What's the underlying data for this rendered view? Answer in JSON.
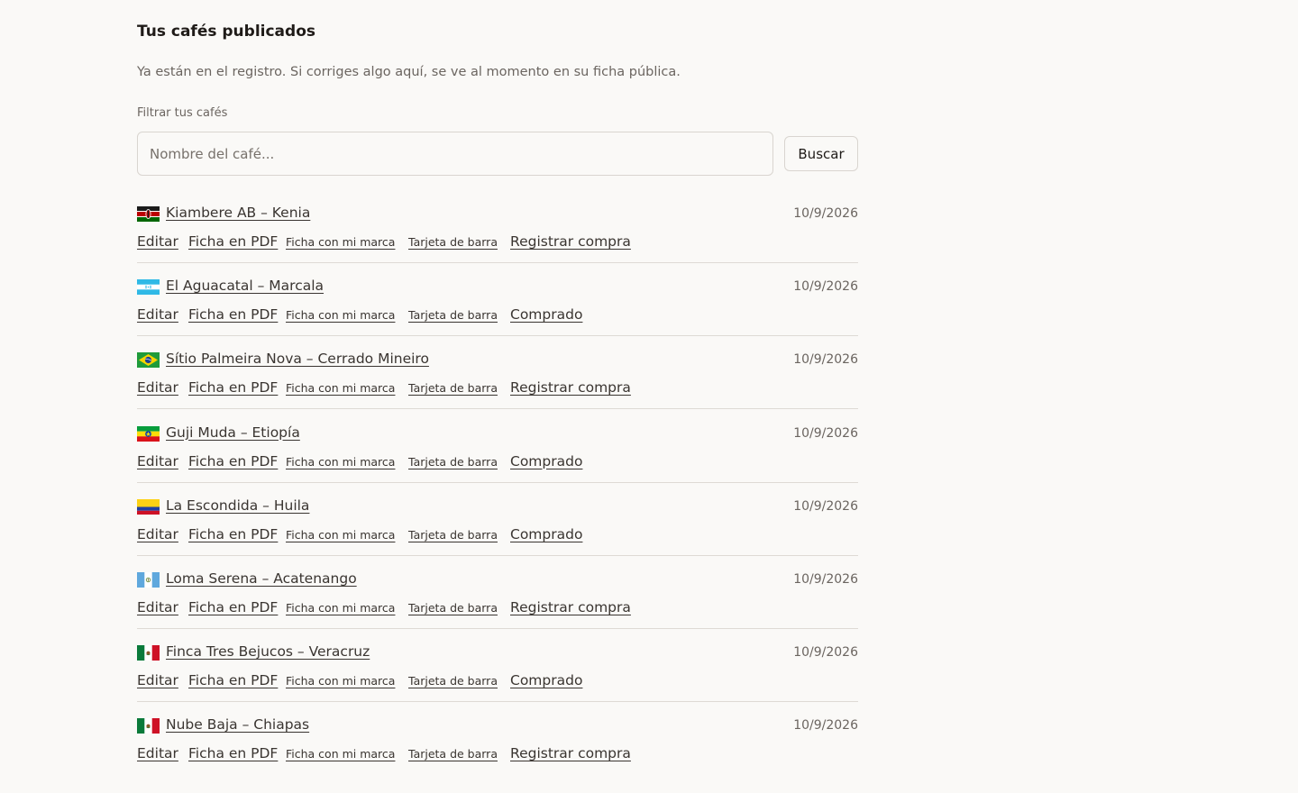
{
  "header": {
    "title": "Tus cafés publicados",
    "subtitle": "Ya están en el registro. Si corriges algo aquí, se ve al momento en su ficha pública."
  },
  "filter": {
    "label": "Filtrar tus cafés",
    "placeholder": "Nombre del café...",
    "value": "",
    "button_label": "Buscar"
  },
  "actions": {
    "edit": "Editar",
    "pdf": "Ficha en PDF",
    "brand": "Ficha con mi marca",
    "bar_card": "Tarjeta de barra",
    "register": "Registrar compra",
    "purchased": "Comprado"
  },
  "coffees": [
    {
      "name": "Kiambere AB – Kenia",
      "date": "10/9/2026",
      "flag": "kenya-flag-icon",
      "status": "register"
    },
    {
      "name": "El Aguacatal – Marcala",
      "date": "10/9/2026",
      "flag": "honduras-flag-icon",
      "status": "purchased"
    },
    {
      "name": "Sítio Palmeira Nova – Cerrado Mineiro",
      "date": "10/9/2026",
      "flag": "brazil-flag-icon",
      "status": "register"
    },
    {
      "name": "Guji Muda – Etiopía",
      "date": "10/9/2026",
      "flag": "ethiopia-flag-icon",
      "status": "purchased"
    },
    {
      "name": "La Escondida – Huila",
      "date": "10/9/2026",
      "flag": "colombia-flag-icon",
      "status": "purchased"
    },
    {
      "name": "Loma Serena – Acatenango",
      "date": "10/9/2026",
      "flag": "guatemala-flag-icon",
      "status": "register"
    },
    {
      "name": "Finca Tres Bejucos – Veracruz",
      "date": "10/9/2026",
      "flag": "mexico-flag-icon",
      "status": "purchased"
    },
    {
      "name": "Nube Baja – Chiapas",
      "date": "10/9/2026",
      "flag": "mexico-flag-icon",
      "status": "register"
    }
  ]
}
